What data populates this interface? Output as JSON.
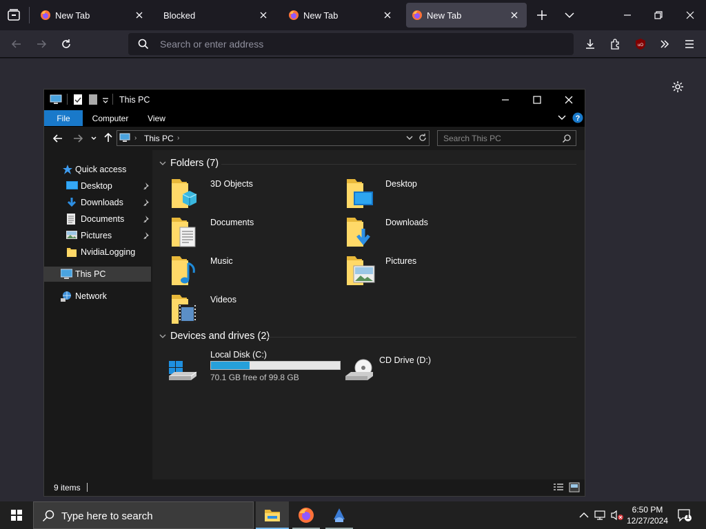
{
  "browser": {
    "tabs": [
      {
        "title": "New Tab",
        "favicon": "firefox-icon"
      },
      {
        "title": "Blocked",
        "favicon": ""
      },
      {
        "title": "New Tab",
        "favicon": "firefox-icon"
      },
      {
        "title": "New Tab",
        "favicon": "firefox-icon",
        "active": true
      }
    ],
    "address_placeholder": "Search or enter address",
    "colors": {
      "accent": "#1979ca",
      "tab_active": "#42414d",
      "ublock": "#800000"
    }
  },
  "explorer": {
    "title": "This PC",
    "ribbon_tabs": [
      "File",
      "Computer",
      "View"
    ],
    "address_crumb": "This PC",
    "search_placeholder": "Search This PC",
    "nav": {
      "quick_access": "Quick access",
      "items": [
        {
          "label": "Desktop",
          "icon": "desktop-icon",
          "pinned": true
        },
        {
          "label": "Downloads",
          "icon": "downloads-icon",
          "pinned": true
        },
        {
          "label": "Documents",
          "icon": "documents-icon",
          "pinned": true
        },
        {
          "label": "Pictures",
          "icon": "pictures-icon",
          "pinned": true
        },
        {
          "label": "NvidiaLogging",
          "icon": "folder-icon",
          "pinned": false
        }
      ],
      "this_pc": "This PC",
      "network": "Network"
    },
    "folders_header": "Folders (7)",
    "folders": [
      {
        "name": "3D Objects",
        "icon": "3d-objects-folder-icon"
      },
      {
        "name": "Desktop",
        "icon": "desktop-folder-icon"
      },
      {
        "name": "Documents",
        "icon": "documents-folder-icon"
      },
      {
        "name": "Downloads",
        "icon": "downloads-folder-icon"
      },
      {
        "name": "Music",
        "icon": "music-folder-icon"
      },
      {
        "name": "Pictures",
        "icon": "pictures-folder-icon"
      },
      {
        "name": "Videos",
        "icon": "videos-folder-icon"
      }
    ],
    "drives_header": "Devices and drives (2)",
    "drives": [
      {
        "name": "Local Disk (C:)",
        "free_text": "70.1 GB free of 99.8 GB",
        "used_fraction": 0.298,
        "icon": "windows-drive-icon"
      },
      {
        "name": "CD Drive (D:)",
        "icon": "cd-drive-icon"
      }
    ],
    "status": "9 items"
  },
  "taskbar": {
    "search_placeholder": "Type here to search",
    "time": "6:50 PM",
    "date": "12/27/2024",
    "notification_count": "1"
  }
}
